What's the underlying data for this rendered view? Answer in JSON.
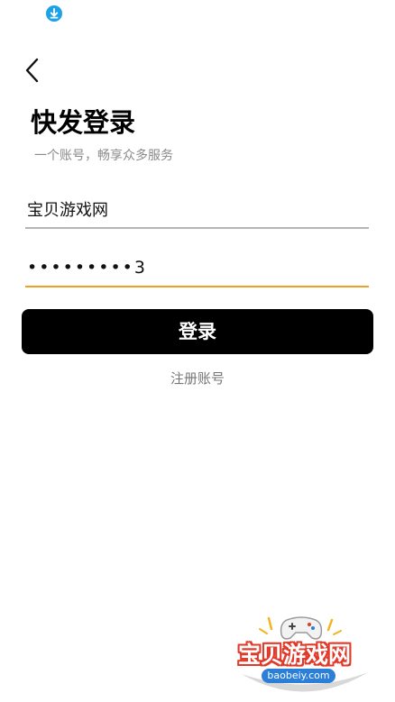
{
  "status_bar": {
    "notification_icon": "download-icon",
    "accent_color": "#1aa3e8"
  },
  "header": {
    "back_icon": "chevron-left-icon"
  },
  "login": {
    "title": "快发登录",
    "subtitle": "一个账号，畅享众多服务",
    "username_value": "宝贝游戏网",
    "password_value": "•••••••••3",
    "login_button_label": "登录",
    "register_link_label": "注册账号"
  },
  "watermark": {
    "name": "宝贝游戏网",
    "url": "baobeiy.com",
    "icon": "gamepad-icon"
  },
  "colors": {
    "button_background": "#000000",
    "active_field_underline": "#f0a020",
    "inactive_field_underline": "#b5b5b5",
    "subtitle_text": "#8a8a8a"
  }
}
